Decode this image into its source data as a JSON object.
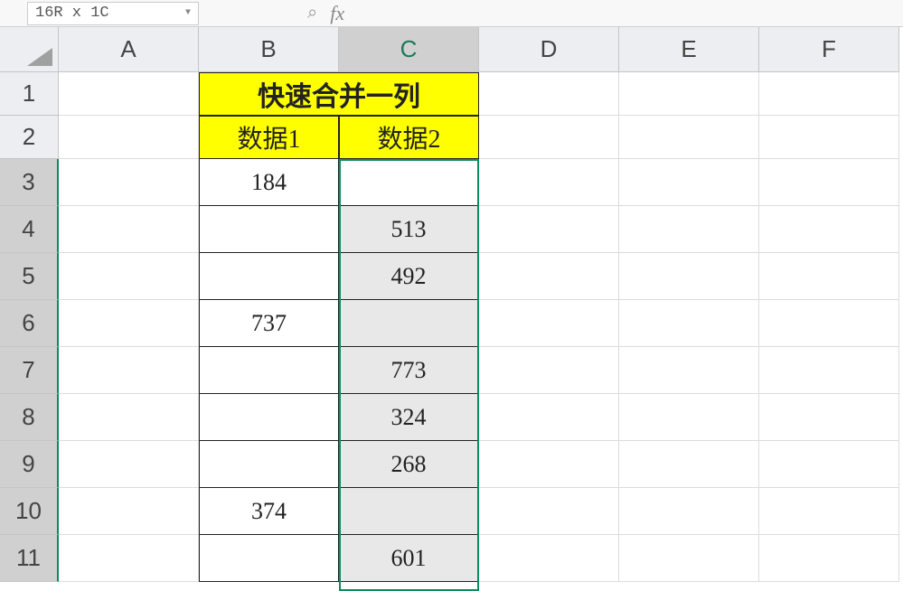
{
  "toolbar": {
    "namebox_value": "16R x 1C",
    "fx_label": "fx"
  },
  "columns": [
    "A",
    "B",
    "C",
    "D",
    "E",
    "F"
  ],
  "rowLabels": [
    "1",
    "2",
    "3",
    "4",
    "5",
    "6",
    "7",
    "8",
    "9",
    "10",
    "11"
  ],
  "merged_title": "快速合并一列",
  "headers": {
    "b": "数据1",
    "c": "数据2"
  },
  "data": {
    "b": [
      "184",
      "",
      "",
      "737",
      "",
      "",
      "",
      "374",
      ""
    ],
    "c": [
      "",
      "513",
      "492",
      "",
      "773",
      "324",
      "268",
      "",
      "601"
    ]
  },
  "activeColumn": "C",
  "selectedRowsFrom": 3
}
